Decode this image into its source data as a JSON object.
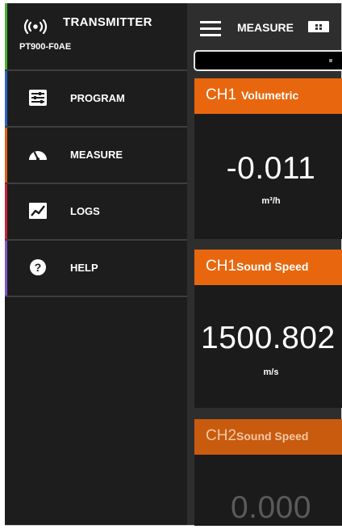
{
  "sidebar": {
    "header": {
      "title": "TRANSMITTER",
      "subtitle": "PT900-F0AE",
      "icon": "broadcast-icon",
      "accent": "#4caf32"
    },
    "items": [
      {
        "label": "PROGRAM",
        "icon": "sliders-icon",
        "accent": "#2b64c8"
      },
      {
        "label": "MEASURE",
        "icon": "gauge-icon",
        "accent": "#e06018"
      },
      {
        "label": "LOGS",
        "icon": "chart-icon",
        "accent": "#c8243a"
      },
      {
        "label": "HELP",
        "icon": "help-icon",
        "accent": "#7b58c6"
      }
    ]
  },
  "topbar": {
    "title": "MEASURE",
    "menu_icon": "hamburger-icon",
    "view_icon": "grid-view-icon"
  },
  "channels": [
    {
      "channel": "CH1",
      "type": "Volumetric",
      "value": "-0.011",
      "unit": "m³/h",
      "active": true
    },
    {
      "channel": "CH1",
      "type": "Sound Speed",
      "value": "1500.802",
      "unit": "m/s",
      "active": true
    },
    {
      "channel": "CH2",
      "type": "Sound Speed",
      "value": "0.000",
      "unit": "",
      "active": false
    }
  ],
  "colors": {
    "header_active": "#e8670e",
    "header_inactive": "#c95b0e",
    "card_bg": "#1b1b1b",
    "sidebar_bg": "#1d1d1d"
  }
}
